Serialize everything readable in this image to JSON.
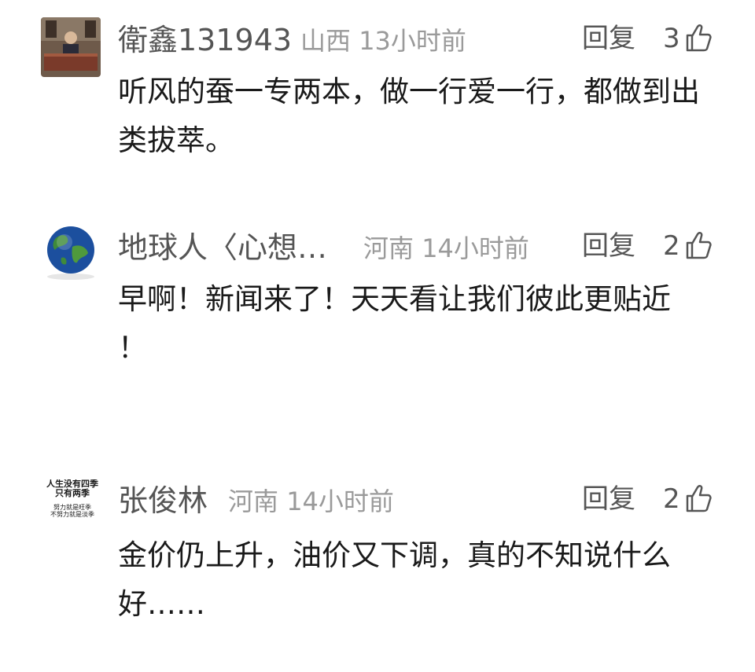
{
  "comments": [
    {
      "username": "衛鑫131943",
      "location": "山西",
      "time": "13小时前",
      "reply_label": "回复",
      "likes": "3",
      "text": "听风的蚕一专两本，做一行爱一行，都做到出类拔萃。",
      "avatar_icon": "person-desk-photo-avatar"
    },
    {
      "username": "地球人〈心想…",
      "location": "河南",
      "time": "14小时前",
      "reply_label": "回复",
      "likes": "2",
      "text": "早啊！新闻来了！天天看让我们彼此更贴近\n！",
      "avatar_icon": "globe-avatar"
    },
    {
      "username": "张俊林",
      "location": "河南",
      "time": "14小时前",
      "reply_label": "回复",
      "likes": "2",
      "text": "金价仍上升，油价又下调，真的不知说什么好……",
      "avatar_icon": "calligraphy-avatar",
      "avatar_text_line1": "人生没有四季",
      "avatar_text_line2": "只有两季",
      "avatar_text_line3": "努力就是旺季",
      "avatar_text_line4": "不努力就是淡季"
    }
  ],
  "colors": {
    "username": "#555555",
    "meta": "#9a9a9a",
    "text": "#1a1a1a"
  }
}
